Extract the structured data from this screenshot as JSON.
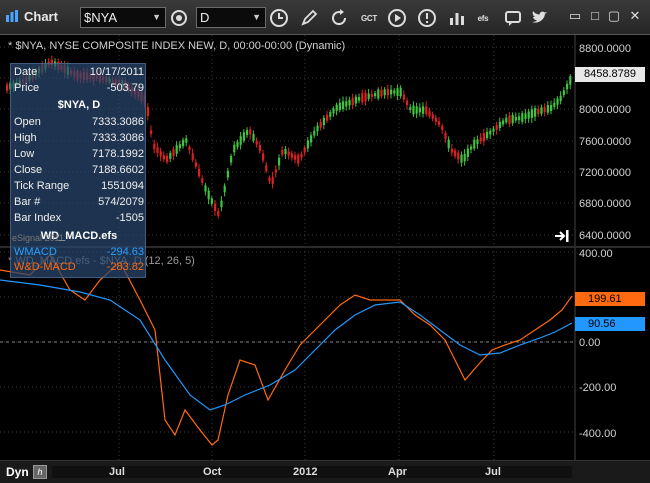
{
  "toolbar": {
    "title": "Chart",
    "symbol": "$NYA",
    "interval": "D",
    "efs_label": "efs",
    "gct_label": "GCT"
  },
  "price_pane": {
    "header": "* $NYA, NYSE COMPOSITE INDEX NEW, D, 00:00-00:00 (Dynamic)",
    "last_price": "8458.8789",
    "axis_ticks": [
      "8800.0000",
      "8400.0000",
      "8000.0000",
      "7600.0000",
      "7200.0000",
      "6800.0000",
      "6400.0000"
    ]
  },
  "macd_pane": {
    "header": "* WD_MACD.efs - $NYA, D (12, 26, 5)",
    "axis_ticks": [
      "400.00",
      "200.00",
      "0.00",
      "-200.00",
      "-400.00"
    ],
    "macd_value": "199.61",
    "signal_value": "90.56"
  },
  "data_window": {
    "date_label": "Date",
    "date_value": "10/17/2011",
    "price_label": "Price",
    "price_value": "-503.79",
    "symbol_title": "$NYA, D",
    "rows": [
      {
        "k": "Open",
        "v": "7333.3086"
      },
      {
        "k": "High",
        "v": "7333.3086"
      },
      {
        "k": "Low",
        "v": "7178.1992"
      },
      {
        "k": "Close",
        "v": "7188.6602"
      },
      {
        "k": "Tick Range",
        "v": "1551094"
      },
      {
        "k": "Bar #",
        "v": "574/2079"
      },
      {
        "k": "Bar Index",
        "v": "-1505"
      }
    ],
    "study_title": "WD_MACD.efs",
    "wmacd_label": "WMACD",
    "wmacd_value": "-294.63",
    "wdmacd_label": "W&D-MACD",
    "wdmacd_value": "-283.82"
  },
  "watermark": "eSignal 2011",
  "bottom": {
    "dyn": "Dyn",
    "x_ticks": [
      "Jul",
      "Oct",
      "2012",
      "Apr",
      "Jul"
    ]
  },
  "colors": {
    "up": "#3ec43e",
    "down": "#e02020",
    "macd": "#ff6a10",
    "signal": "#2098ff"
  }
}
